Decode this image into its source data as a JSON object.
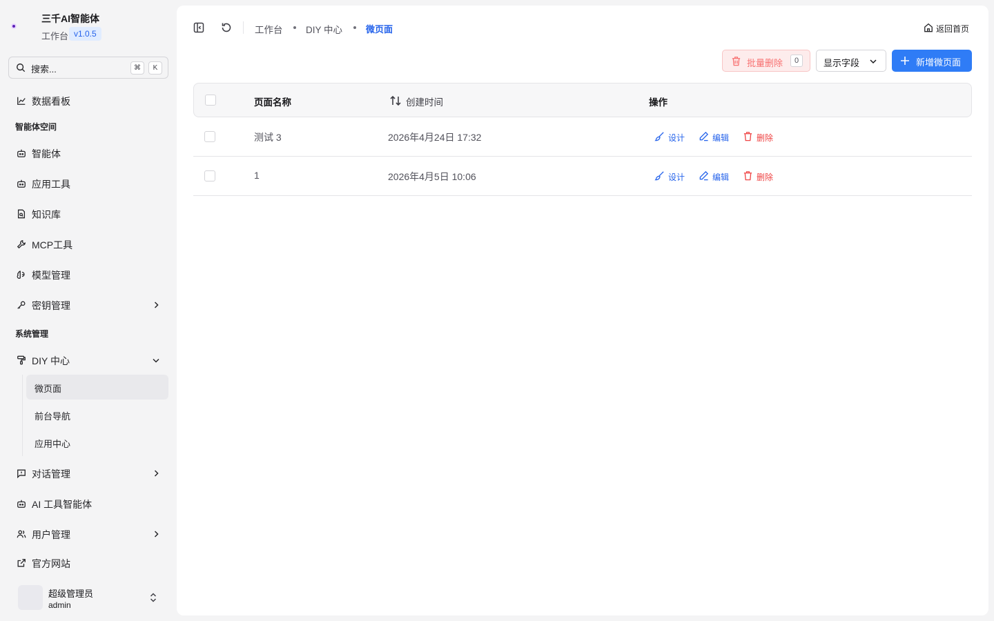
{
  "brand": {
    "name": "三千AI智能体",
    "subtitle": "工作台",
    "version": "v1.0.5"
  },
  "search": {
    "placeholder": "搜索...",
    "kbd_cmd": "⌘",
    "kbd_key": "K"
  },
  "nav": {
    "dashboard": "数据看板",
    "section_agent_space": "智能体空间",
    "agents": "智能体",
    "app_tools": "应用工具",
    "knowledge": "知识库",
    "mcp_tools": "MCP工具",
    "models": "模型管理",
    "keys": "密钥管理",
    "section_system": "系统管理",
    "diy_center": "DIY 中心",
    "diy_sub": [
      "微页面",
      "前台导航",
      "应用中心"
    ],
    "chat_mgmt": "对话管理",
    "ai_tool_agent": "AI 工具智能体",
    "user_mgmt": "用户管理",
    "official_site": "官方网站"
  },
  "user": {
    "name": "超级管理员",
    "id": "admin"
  },
  "breadcrumb": [
    "工作台",
    "DIY 中心",
    "微页面"
  ],
  "home_link": "返回首页",
  "toolbar": {
    "batch_delete": "批量删除",
    "selected_count": "0",
    "display_fields": "显示字段",
    "add_page": "新增微页面"
  },
  "table": {
    "headers": {
      "name": "页面名称",
      "created": "创建时间",
      "actions": "操作"
    },
    "rows": [
      {
        "name": "测试 3",
        "created": "2026年4月24日 17:32"
      },
      {
        "name": "1",
        "created": "2026年4月5日 10:06"
      }
    ],
    "actions": {
      "design": "设计",
      "edit": "编辑",
      "delete": "删除"
    }
  },
  "colors": {
    "accent": "#2f7cf6",
    "danger": "#ef4444",
    "sidebar_bg": "#f4f4f5"
  }
}
